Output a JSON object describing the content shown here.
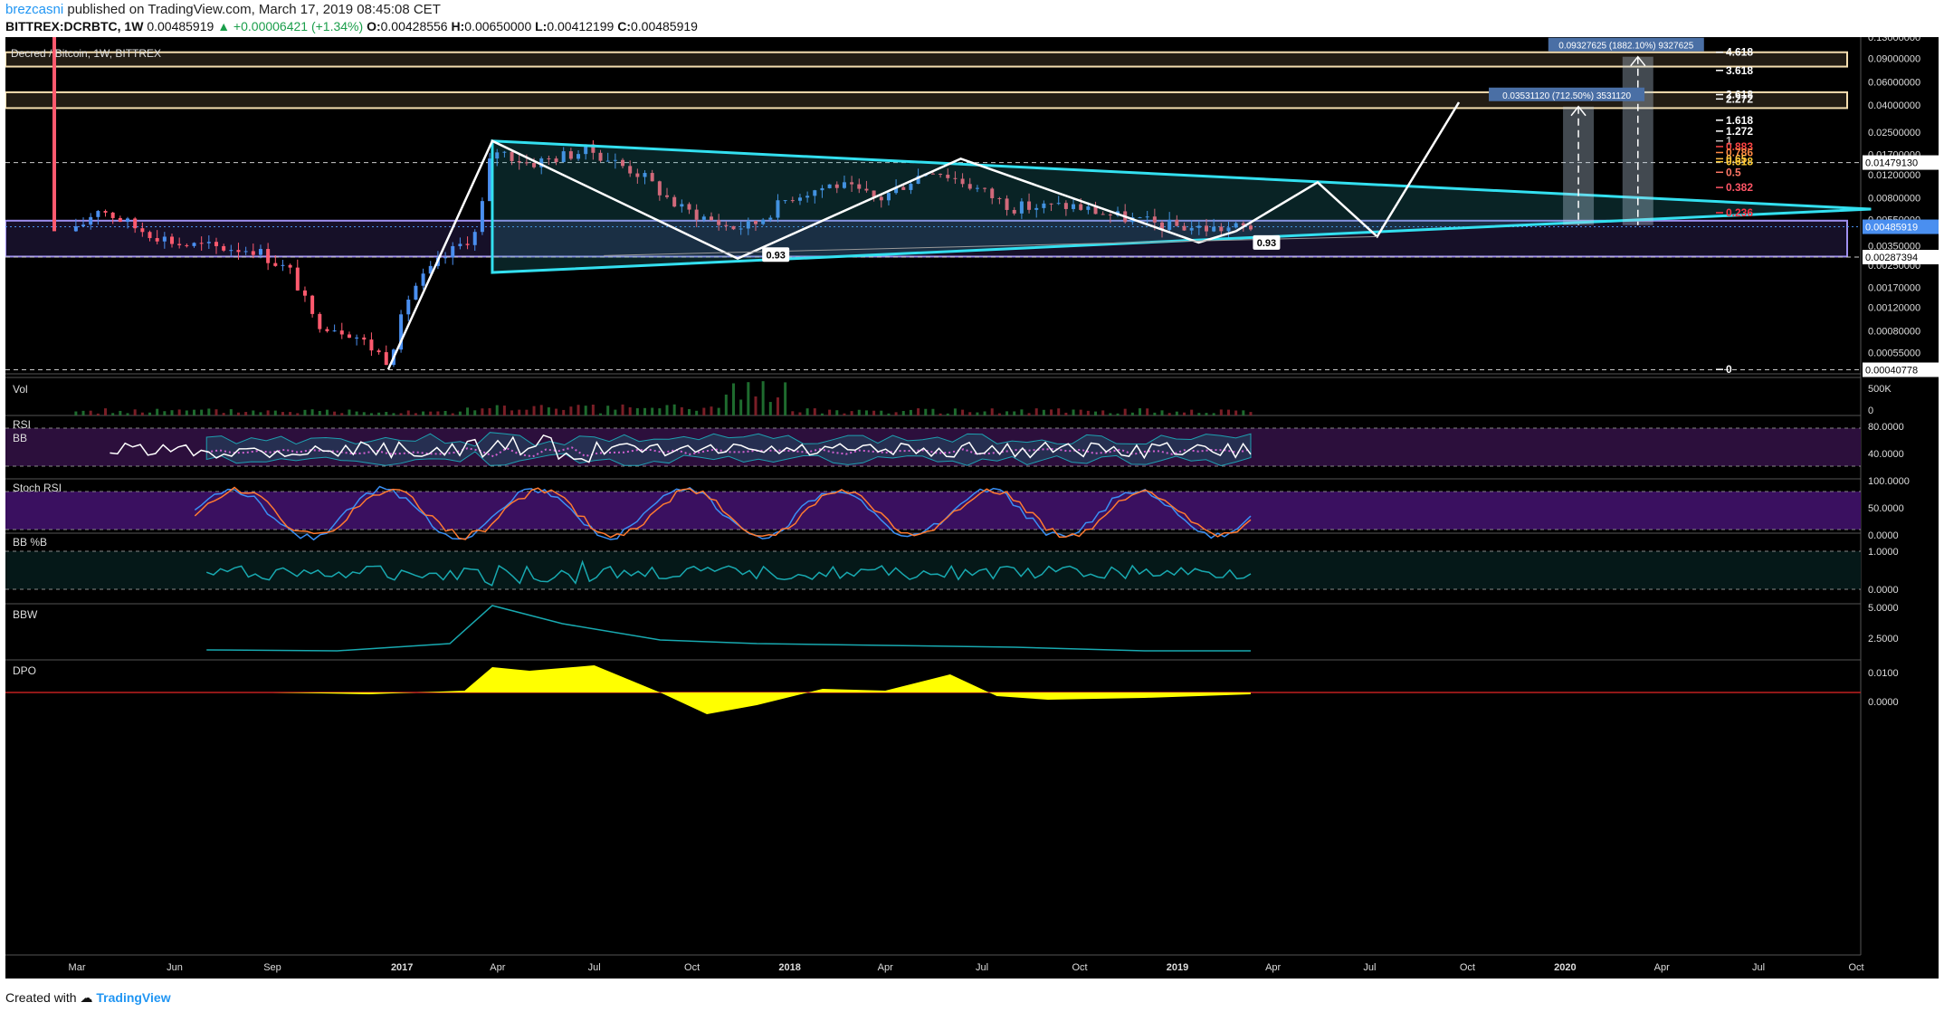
{
  "header": {
    "user": "brezcasni",
    "published": "published on TradingView.com, March 17, 2019 08:45:08 CET",
    "symbol": "BITTREX:DCRBTC, 1W",
    "last": "0.00485919",
    "change": "▲ +0.00006421 (+1.34%)",
    "open_label": "O:",
    "open": "0.00428556",
    "high_label": "H:",
    "high": "0.00650000",
    "low_label": "L:",
    "low": "0.00412199",
    "close_label": "C:",
    "close": "0.00485919"
  },
  "footer": {
    "created_with": "Created with",
    "brand": "TradingView"
  },
  "colors": {
    "background": "#000000",
    "up": "#4a8ff0",
    "down": "#ff5a6e",
    "cyan": "#33e0f0",
    "white": "#ffffff",
    "rsi_bg": "#2c0f3c",
    "stoch_bg": "#3a1060",
    "bbpb_bg": "#051818",
    "dpo_fill": "#ffff00",
    "bbw_line": "#18a9b0",
    "label_bg": "#4a6fa5"
  },
  "chart_data": [
    {
      "type": "candlestick",
      "title": "Decred / Bitcoin, 1W, BITTREX",
      "y_scale": "log",
      "ylim": [
        0.00038,
        0.13
      ],
      "y_ticks": [
        "0.13000000",
        "0.09000000",
        "0.06000000",
        "0.04000000",
        "0.02500000",
        "0.01700000",
        "0.01200000",
        "0.00800000",
        "0.00550000",
        "0.00350000",
        "0.00250000",
        "0.00170000",
        "0.00120000",
        "0.00080000",
        "0.00055000"
      ],
      "price_labels": [
        "0.01479130",
        "0.00485919",
        "0.00287394",
        "0.00040778"
      ],
      "x_labels": [
        "Mar",
        "Jun",
        "Sep",
        "2017",
        "Apr",
        "Jul",
        "Oct",
        "2018",
        "Apr",
        "Jul",
        "Oct",
        "2019",
        "Apr",
        "Jul",
        "Oct",
        "2020",
        "Apr",
        "Jul",
        "Oct"
      ],
      "close_path": [
        [
          "2016-02-29",
          0.0045
        ],
        [
          "2016-03-21",
          0.0068
        ],
        [
          "2016-04-25",
          0.0048
        ],
        [
          "2016-06-06",
          0.0036
        ],
        [
          "2016-07-11",
          0.0034
        ],
        [
          "2016-08-15",
          0.0033
        ],
        [
          "2016-09-19",
          0.0022
        ],
        [
          "2016-10-10",
          0.00095
        ],
        [
          "2016-11-14",
          0.00078
        ],
        [
          "2016-12-19",
          0.00048
        ],
        [
          "2017-01-09",
          0.0016
        ],
        [
          "2017-02-06",
          0.0027
        ],
        [
          "2017-03-13",
          0.0045
        ],
        [
          "2017-03-27",
          0.019
        ],
        [
          "2017-05-01",
          0.0145
        ],
        [
          "2017-06-26",
          0.0185
        ],
        [
          "2017-08-14",
          0.012
        ],
        [
          "2017-09-18",
          0.0068
        ],
        [
          "2017-11-06",
          0.0048
        ],
        [
          "2017-11-27",
          0.005
        ],
        [
          "2018-01-01",
          0.0082
        ],
        [
          "2018-02-12",
          0.0102
        ],
        [
          "2018-03-26",
          0.0078
        ],
        [
          "2018-05-14",
          0.0135
        ],
        [
          "2018-06-18",
          0.0102
        ],
        [
          "2018-07-30",
          0.0068
        ],
        [
          "2018-09-24",
          0.007
        ],
        [
          "2018-11-05",
          0.0058
        ],
        [
          "2018-12-17",
          0.005
        ],
        [
          "2019-02-04",
          0.0047
        ],
        [
          "2019-03-11",
          0.00485919
        ]
      ],
      "fib_levels": [
        {
          "label": "4.618",
          "price": 0.1
        },
        {
          "label": "3.618",
          "price": 0.073
        },
        {
          "label": "2.618",
          "price": 0.048
        },
        {
          "label": "2.272",
          "price": 0.0445
        },
        {
          "label": "1.618",
          "price": 0.0308
        },
        {
          "label": "1.272",
          "price": 0.0255
        },
        {
          "label": "1",
          "price": 0.0215
        },
        {
          "label": "0.883",
          "price": 0.0195
        },
        {
          "label": "0.786",
          "price": 0.0176
        },
        {
          "label": "0.65",
          "price": 0.0158
        },
        {
          "label": "0.618",
          "price": 0.015
        },
        {
          "label": "0.5",
          "price": 0.0125
        },
        {
          "label": "0.382",
          "price": 0.0096
        },
        {
          "label": "0.236",
          "price": 0.0062
        },
        {
          "label": "0",
          "price": 0.00041
        }
      ],
      "fib_colors": [
        "#ffffff",
        "#ffffff",
        "#ffffff",
        "#ffffff",
        "#ffffff",
        "#ffffff",
        "#bbbbbb",
        "#ff4444",
        "#ff8844",
        "#ffbb44",
        "#ffcc33",
        "#ff7766",
        "#ff5566",
        "#ff3344",
        "#ffffff"
      ],
      "measure_labels": [
        "0.09327625 (1882.10%) 9327625",
        "0.03531120 (712.50%) 3531120"
      ],
      "trend_labels": [
        "0.93",
        "0.93"
      ]
    },
    {
      "type": "bar",
      "title": "Vol",
      "y_ticks": [
        "500K",
        "0"
      ]
    },
    {
      "type": "line",
      "title": "RSI",
      "subtitle": "BB",
      "y_ticks": [
        "80.0000",
        "40.0000"
      ]
    },
    {
      "type": "line",
      "title": "Stoch RSI",
      "y_ticks": [
        "100.0000",
        "50.0000",
        "0.0000"
      ]
    },
    {
      "type": "line",
      "title": "BB %B",
      "y_ticks": [
        "1.0000",
        "0.0000"
      ]
    },
    {
      "type": "line",
      "title": "BBW",
      "y_ticks": [
        "5.0000",
        "2.5000"
      ]
    },
    {
      "type": "area",
      "title": "DPO",
      "y_ticks": [
        "0.0100",
        "0.0000"
      ]
    }
  ]
}
